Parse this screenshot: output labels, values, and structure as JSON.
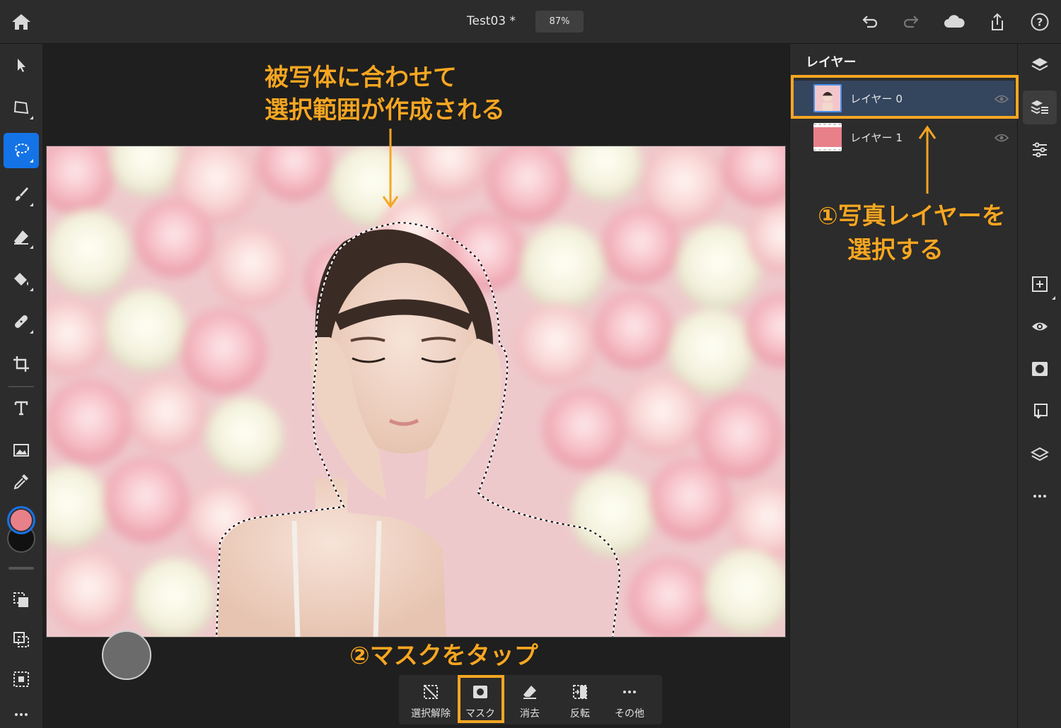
{
  "header": {
    "title": "Test03 *",
    "zoom": "87%",
    "icons": [
      "home-icon",
      "undo-icon",
      "redo-icon",
      "cloud-icon",
      "share-icon",
      "help-icon"
    ]
  },
  "left_tools": [
    "select-icon",
    "transform-icon",
    "lasso-icon",
    "brush-icon",
    "eraser-icon",
    "fill-icon",
    "healing-icon",
    "crop-icon",
    "type-icon",
    "image-icon",
    "eyedropper-icon"
  ],
  "colors": {
    "foreground": "#e8808a",
    "background": "#111111",
    "accent": "#1473e6",
    "annotation": "#f5a623"
  },
  "layers_panel": {
    "title": "レイヤー",
    "layers": [
      {
        "name": "レイヤー 0",
        "selected": true
      },
      {
        "name": "レイヤー 1",
        "selected": false
      }
    ]
  },
  "annotations": {
    "top_line1": "被写体に合わせて",
    "top_line2": "選択範囲が作成される",
    "right_line1": "①写真レイヤーを",
    "right_line2": "選択する",
    "bottom": "②マスクをタップ"
  },
  "selection_bar": {
    "items": [
      {
        "label": "選択解除",
        "icon": "deselect-icon"
      },
      {
        "label": "マスク",
        "icon": "mask-icon"
      },
      {
        "label": "消去",
        "icon": "erase-icon"
      },
      {
        "label": "反転",
        "icon": "invert-icon"
      },
      {
        "label": "その他",
        "icon": "more-icon"
      }
    ]
  }
}
